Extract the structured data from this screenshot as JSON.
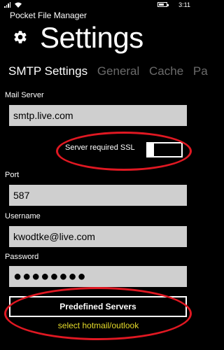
{
  "status_bar": {
    "time": "3:11"
  },
  "app": {
    "name": "Pocket File Manager"
  },
  "page": {
    "title": "Settings"
  },
  "pivot": {
    "tabs": [
      {
        "label": "SMTP Settings",
        "active": true
      },
      {
        "label": "General",
        "active": false
      },
      {
        "label": "Cache",
        "active": false
      },
      {
        "label": "Pa",
        "active": false
      }
    ]
  },
  "form": {
    "mail_server": {
      "label": "Mail Server",
      "value": "smtp.live.com"
    },
    "ssl": {
      "label": "Server required SSL",
      "checked": false
    },
    "port": {
      "label": "Port",
      "value": "587"
    },
    "username": {
      "label": "Username",
      "value": "kwodtke@live.com"
    },
    "password": {
      "label": "Password",
      "masked_value": "●●●●●●●●"
    }
  },
  "predefined": {
    "button_label": "Predefined Servers",
    "hint": "select hotmail/outlook"
  },
  "colors": {
    "annotation": "#e01822",
    "hint": "#e6dc2a",
    "input_bg": "#cfcfcf",
    "inactive_tab": "#6b6b6b"
  },
  "icons": {
    "app": "gear-icon"
  }
}
